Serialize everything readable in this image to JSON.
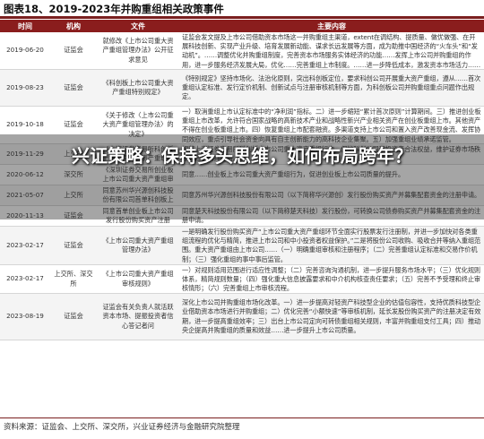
{
  "figure_title": "图表18、2019-2023年并购重组相关政策事件",
  "table": {
    "headers": [
      "时间",
      "机构",
      "文件",
      "主要内容"
    ],
    "rows": [
      {
        "date": "2019-06-20",
        "institution": "证监会",
        "document": "就修改《上市公司重大资产重组管理办法》公开征求意见",
        "content": "证监会发文提及上市公司借助资本市场这一并购重组主渠道，extent在调结构、提质量、做优做强、在开展科技创新、实现产业升级、培育发展新动能、谋求长远发展等方面，成为助推中国经济的“火车头”和“发动机”。……调整优化并购重组制度，完善资本市场服务实体经济的功能……发挥上市公司并购重组的作用，进一步服务经济发展大局，优化……完善重组上市制度。……进一步降低成本，激发资本市场活力……上市公司进一步提高质量和效益，理顺重组上市的规则，把握好上市公司重组审核的节奏，……开展了系统性研究。"
      },
      {
        "date": "2019-08-23",
        "institution": "证监会",
        "document": "《科创板上市公司重大资产重组特别规定》",
        "content": "《特别规定》坚持市场化、法治化原则，突出科创板定位，要求科创公司开展重大资产重组，遵从……首次重组认定标准、发行定价机制、创新试点与注册审核机制等方面，为科创板公司并购重组重点问题作出规定。"
      },
      {
        "date": "2019-10-18",
        "institution": "证监会",
        "document": "《关于修改〈上市公司重大资产重组管理办法〉的决定》",
        "content": "一）取消重组上市认定标准中的“净利润”指标。二）进一步缩短“累计首次原则”计算期间。三）推进创业板重组上市改革，允许符合国家战略的高新技术产业和战略性新兴产业相关资产在创业板重组上市。其他资产不得在创业板重组上市。四）恢复重组上市配套融资。多渠道支持上市公司和置入资产改善现金流、发挥协同效应，重点引导社会资金向具有自主创新能力的高科技企业集聚。五）加强重组业绩承诺监管。"
      },
      {
        "date": "2019-11-29",
        "institution": "上交所",
        "document": "《上海证券交易所科创板上市公司重大资产重组审核规则》",
        "content": "规范上海证券交易所科创板上市公司重大资产重组行为，保护科创公司和投资者合法权益，维护证券市场秩序和社会公共利益。"
      },
      {
        "date": "2020-06-12",
        "institution": "深交所",
        "document": "《深圳证券交易所创业板上市公司重大资产重组审核规则》",
        "content": "同意……创业板上市公司重大资产重组行为，促进创业板上市公司质量的提升。"
      },
      {
        "date": "2021-05-07",
        "institution": "上交所",
        "document": "同意苏州华兴源创科技股份有限公司首单科创板上市公司发行股份购买资产注册",
        "content": "同意苏州华兴源创科技股份有限公司（以下简称华兴源创）发行股份购买资产并募集配套资金的注册申请。"
      },
      {
        "date": "2020-11-13",
        "institution": "证监会",
        "document": "同意首单创业板上市公司发行股份购买资产注册",
        "content": "同意楚天科技股份有限公司（以下简称楚天科技）发行股份，可转换公司债券购买资产并募集配套资金的注册申请。"
      },
      {
        "date": "2023-02-17",
        "institution": "证监会",
        "document": "《上市公司重大资产重组管理办法》",
        "content": "一是明确发行股份购买资产“上市公司重大资产重组环节全面实行股票发行注册制，并进一步加快对各类重组流程的优化与精简，推进上市公司和中小投资者权益保护。”二是将股份公司收购、吸收合并等纳入重组范围。重大资产重组由上市公司……（一）明确重组审核和注册程序；（二）完善重组认定标准和交易作价机制；（三）强化重组的事中事后监管。"
      },
      {
        "date": "2023-02-17",
        "institution": "上交所、深交所",
        "document": "《上市公司重大资产重组审核规则》",
        "content": "一）对规则适用范围进行适应性调整；（二）完善咨询沟通机制，进一步提升服务市场水平；（三）优化规则体系，精简规则数量；（四）强化重大信息披露要求和中介机构核查责任要求；（五）完善不予受理和终止审核情形；（六）完善重组上市审核流程。"
      },
      {
        "date": "2023-08-19",
        "institution": "证监会",
        "document": "证监会有关负责人就活跃资本市场、提振投资者信心答记者问",
        "content": "深化上市公司并购重组市场化改革。一）进一步提高对轻资产科技型企业的估值包容性，支持优质科技型企业借助资本市场进行并购重组；二）优化完善“小额快速”等审核机制，延长发股份购买资产的注册决定有效期，进一步提高重组效率；三）出台上市公司定向可转债重组相关规则，丰富并购重组支付工具；四）推动央企提高并购重组的质量和效益……进一步提升上市公司质量。"
      }
    ]
  },
  "source": "资料来源：证监会、上交所、深交所，兴业证券经济与金融研究院整理",
  "overlay_title": "兴证策略：保持多头思维，如何布局跨年？"
}
